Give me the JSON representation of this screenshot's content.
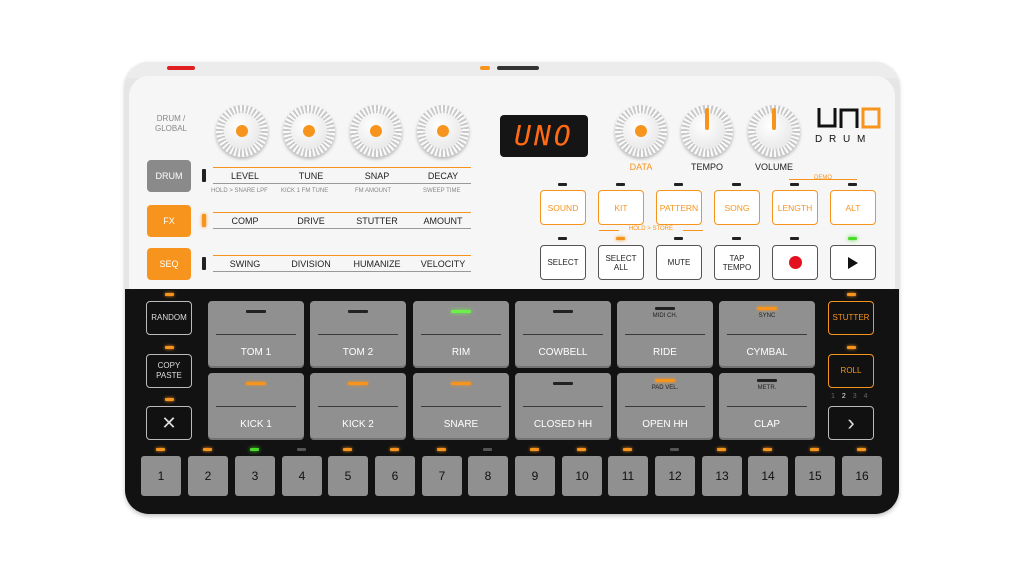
{
  "knob_labels": {
    "drum_global": "DRUM / GLOBAL",
    "data": "DATA",
    "tempo": "TEMPO",
    "volume": "VOLUME"
  },
  "display": {
    "text": "UNO"
  },
  "logo": {
    "word": "D R U M"
  },
  "modes": [
    {
      "label": "DRUM",
      "color": "#8a8a8a"
    },
    {
      "label": "FX",
      "color": "#f7941d"
    },
    {
      "label": "SEQ",
      "color": "#f7941d"
    }
  ],
  "drum_params": [
    "LEVEL",
    "TUNE",
    "SNAP",
    "DECAY"
  ],
  "drum_sub": [
    "HOLD > SNARE LPF",
    "KICK 1 FM TUNE",
    "FM AMOUNT",
    "SWEEP TIME"
  ],
  "fx_params": [
    "COMP",
    "DRIVE",
    "STUTTER",
    "AMOUNT"
  ],
  "seq_params": [
    "SWING",
    "DIVISION",
    "HUMANIZE",
    "VELOCITY"
  ],
  "top_buttons": [
    "SOUND",
    "KIT",
    "PATTERN",
    "SONG",
    "LENGTH",
    "ALT"
  ],
  "demo_label": "DEMO",
  "hold_store": "HOLD > STORE",
  "second_buttons": [
    "SELECT",
    "SELECT ALL",
    "MUTE",
    "TAP TEMPO"
  ],
  "pads": [
    {
      "label": "TOM 1",
      "sub": "",
      "led": "off"
    },
    {
      "label": "TOM 2",
      "sub": "",
      "led": "off"
    },
    {
      "label": "RIM",
      "sub": "",
      "led": "green"
    },
    {
      "label": "COWBELL",
      "sub": "",
      "led": "off"
    },
    {
      "label": "RIDE",
      "sub": "MIDI CH.",
      "led": "off"
    },
    {
      "label": "CYMBAL",
      "sub": "SYNC",
      "led": "orange"
    },
    {
      "label": "KICK 1",
      "sub": "",
      "led": "orange"
    },
    {
      "label": "KICK 2",
      "sub": "",
      "led": "orange"
    },
    {
      "label": "SNARE",
      "sub": "",
      "led": "orange"
    },
    {
      "label": "CLOSED HH",
      "sub": "",
      "led": "off"
    },
    {
      "label": "OPEN HH",
      "sub": "PAD VEL.",
      "led": "orange"
    },
    {
      "label": "CLAP",
      "sub": "METR.",
      "led": "off"
    }
  ],
  "left_buttons": {
    "random": "RANDOM",
    "copy_paste": "COPY PASTE",
    "clear": "✕"
  },
  "right_buttons": {
    "stutter": "STUTTER",
    "roll": "ROLL",
    "next": "›"
  },
  "roll_indicator": {
    "values": [
      "1",
      "2",
      "3",
      "4"
    ],
    "active": "2"
  },
  "steps": [
    "1",
    "2",
    "3",
    "4",
    "5",
    "6",
    "7",
    "8",
    "9",
    "10",
    "11",
    "12",
    "13",
    "14",
    "15",
    "16"
  ],
  "step_leds": [
    "orange",
    "orange",
    "green",
    "dim",
    "orange",
    "orange",
    "orange",
    "dim",
    "orange",
    "orange",
    "orange",
    "dim",
    "orange",
    "orange",
    "orange",
    "orange"
  ],
  "colors": {
    "accent": "#f7941d",
    "panel": "#f6f6f6",
    "dark": "#121212",
    "pad": "#909090",
    "led_green": "#4bdb2b"
  }
}
